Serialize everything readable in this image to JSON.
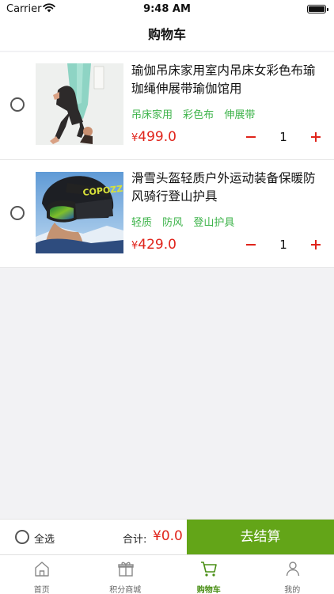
{
  "status_bar": {
    "carrier": "Carrier",
    "time": "9:48 AM"
  },
  "nav": {
    "title": "购物车"
  },
  "cart": {
    "items": [
      {
        "title": "瑜伽吊床家用室内吊床女彩色布瑜珈绳伸展带瑜伽馆用",
        "tags": [
          "吊床家用",
          "彩色布",
          "伸展带"
        ],
        "currency": "¥",
        "price": "499.0",
        "quantity": "1",
        "selected": false
      },
      {
        "title": "滑雪头盔轻质户外运动装备保暖防风骑行登山护具",
        "tags": [
          "轻质",
          "防风",
          "登山护具"
        ],
        "currency": "¥",
        "price": "429.0",
        "quantity": "1",
        "selected": false
      }
    ]
  },
  "checkout": {
    "select_all_label": "全选",
    "total_label": "合计:",
    "total_value": "¥0.0",
    "button_label": "去结算"
  },
  "tabs": [
    {
      "label": "首页",
      "icon": "home-icon",
      "active": false
    },
    {
      "label": "积分商城",
      "icon": "gift-icon",
      "active": false
    },
    {
      "label": "购物车",
      "icon": "cart-icon",
      "active": true
    },
    {
      "label": "我的",
      "icon": "user-icon",
      "active": false
    }
  ],
  "colors": {
    "accent_green": "#63a518",
    "tag_green": "#3db34a",
    "price_red": "#e0241b"
  }
}
